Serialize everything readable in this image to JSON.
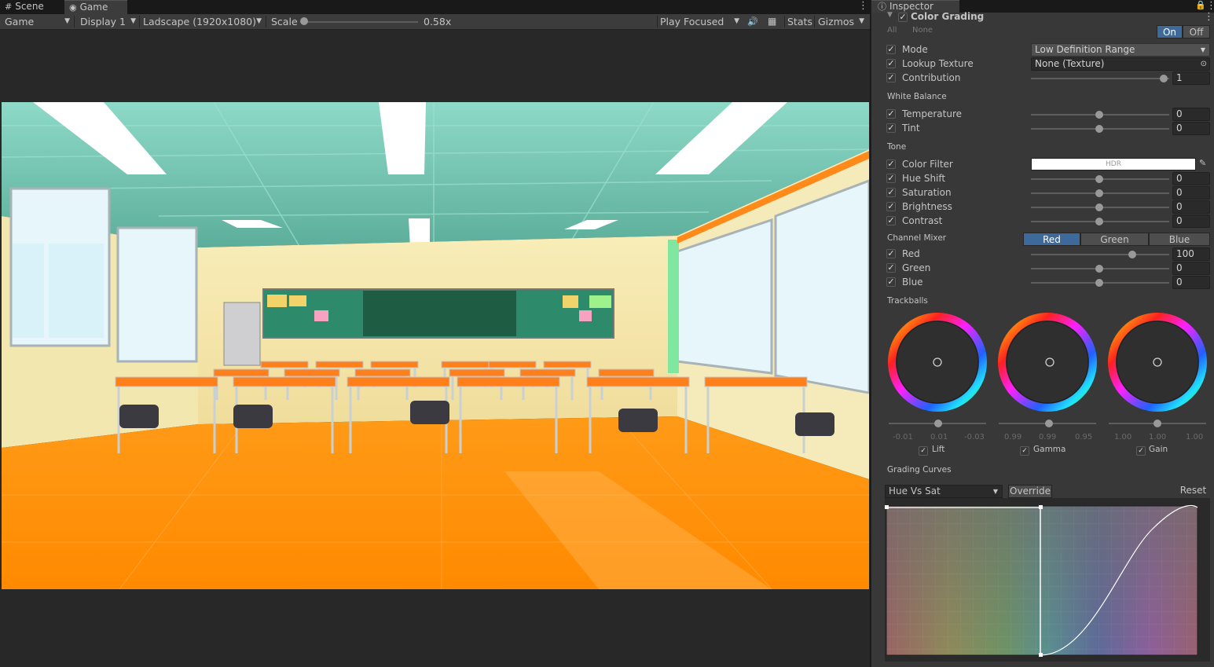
{
  "tabs": {
    "scene": "Scene",
    "game": "Game",
    "inspector": "Inspector"
  },
  "toolbar": {
    "view_mode": "Game",
    "display": "Display 1",
    "resolution": "Ladscape (1920x1080)",
    "scale_label": "Scale",
    "scale_value": "0.58x",
    "play_mode": "Play Focused",
    "stats": "Stats",
    "gizmos": "Gizmos"
  },
  "inspector": {
    "component": "Color Grading",
    "all": "All",
    "none": "None",
    "on": "On",
    "off": "Off",
    "mode": {
      "label": "Mode",
      "value": "Low Definition Range"
    },
    "lookup": {
      "label": "Lookup Texture",
      "value": "None (Texture)"
    },
    "contribution": {
      "label": "Contribution",
      "value": "1"
    },
    "white_balance": "White Balance",
    "temperature": {
      "label": "Temperature",
      "value": "0"
    },
    "tint": {
      "label": "Tint",
      "value": "0"
    },
    "tone": "Tone",
    "color_filter": {
      "label": "Color Filter",
      "value": "HDR"
    },
    "hue_shift": {
      "label": "Hue Shift",
      "value": "0"
    },
    "saturation": {
      "label": "Saturation",
      "value": "0"
    },
    "brightness": {
      "label": "Brightness",
      "value": "0"
    },
    "contrast": {
      "label": "Contrast",
      "value": "0"
    },
    "channel_mixer": "Channel Mixer",
    "mixer_tabs": [
      "Red",
      "Green",
      "Blue"
    ],
    "mixer_red": {
      "label": "Red",
      "value": "100"
    },
    "mixer_green": {
      "label": "Green",
      "value": "0"
    },
    "mixer_blue": {
      "label": "Blue",
      "value": "0"
    },
    "trackballs": "Trackballs",
    "lift": {
      "label": "Lift",
      "values": [
        "-0.01",
        "0.01",
        "-0.03"
      ]
    },
    "gamma": {
      "label": "Gamma",
      "values": [
        "0.99",
        "0.99",
        "0.95"
      ]
    },
    "gain": {
      "label": "Gain",
      "values": [
        "1.00",
        "1.00",
        "1.00"
      ]
    },
    "grading_curves": "Grading Curves",
    "curve_select": "Hue Vs Sat",
    "override": "Override",
    "reset": "Reset"
  },
  "colors": {
    "accent": "#3d6a9b",
    "floor": "#ff9a17",
    "ceiling": "#6fbfab"
  }
}
